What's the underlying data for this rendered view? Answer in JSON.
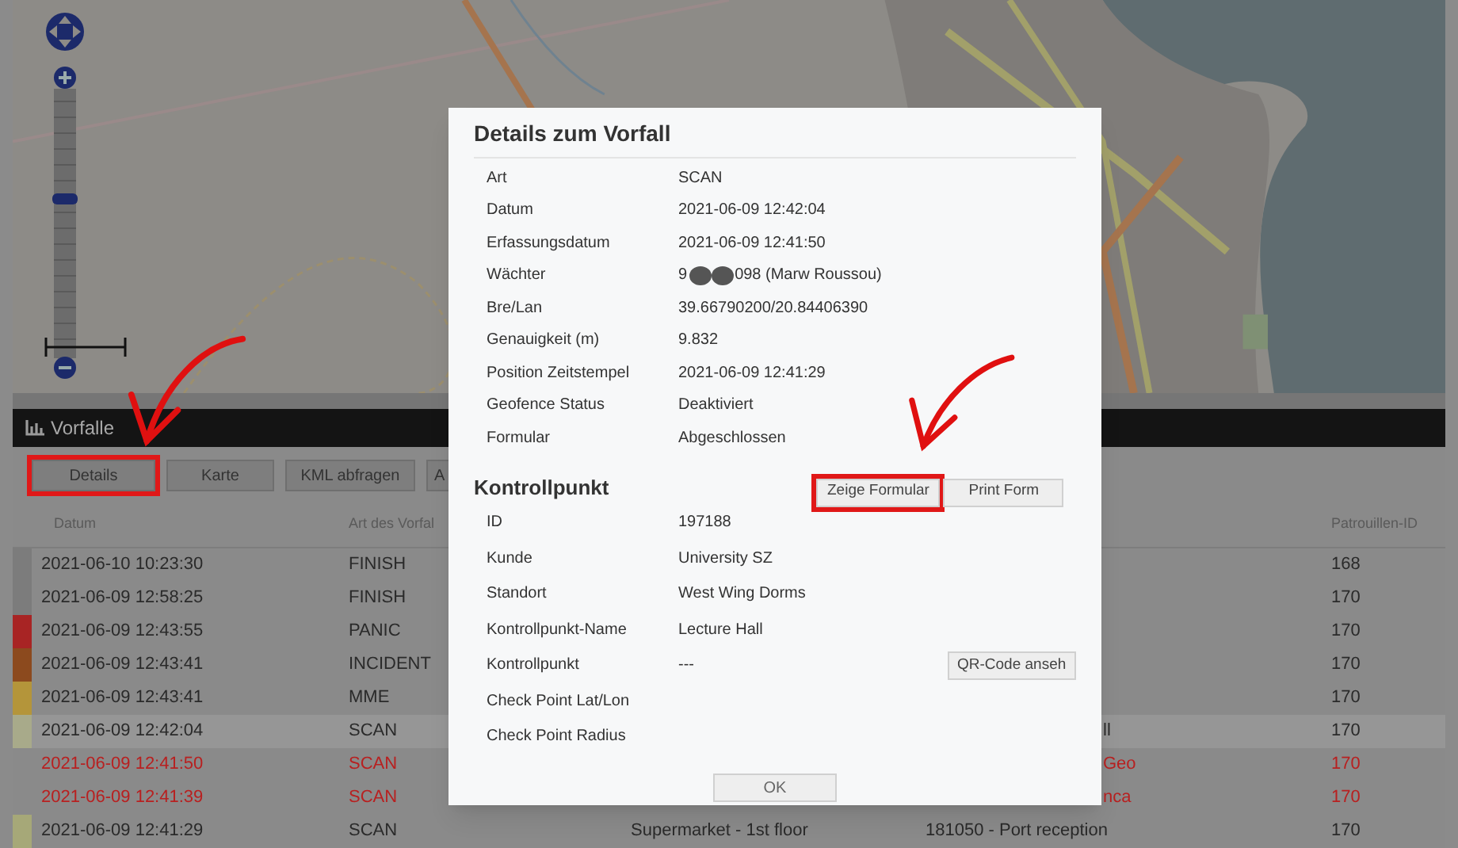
{
  "panel": {
    "title": "Vorfalle"
  },
  "toolbar": [
    {
      "label": "Details",
      "highlighted": true
    },
    {
      "label": "Karte",
      "highlighted": false
    },
    {
      "label": "KML abfragen",
      "highlighted": false
    },
    {
      "label": "A",
      "highlighted": false
    }
  ],
  "table": {
    "columns": [
      "Datum",
      "Art des Vorfal",
      "Patrouillen-ID"
    ],
    "rows": [
      {
        "date": "2021-06-10 10:23:30",
        "type": "FINISH",
        "patrol_id": "168",
        "color": "#7c7c7c",
        "alert": false,
        "selected": false
      },
      {
        "date": "2021-06-09 12:58:25",
        "type": "FINISH",
        "patrol_id": "170",
        "color": "#7c7c7c",
        "alert": false,
        "selected": false
      },
      {
        "date": "2021-06-09 12:43:55",
        "type": "PANIC",
        "patrol_id": "170",
        "color": "#a82424",
        "alert": false,
        "selected": false
      },
      {
        "date": "2021-06-09 12:43:41",
        "type": "INCIDENT",
        "patrol_id": "170",
        "color": "#8c4a1e",
        "alert": false,
        "selected": false
      },
      {
        "date": "2021-06-09 12:43:41",
        "type": "MME",
        "patrol_id": "170",
        "color": "#b4953a",
        "alert": false,
        "selected": false
      },
      {
        "date": "2021-06-09 12:42:04",
        "type": "SCAN",
        "column_4": "ll",
        "patrol_id": "170",
        "color": "#a8aa8a",
        "alert": false,
        "selected": true
      },
      {
        "date": "2021-06-09 12:41:50",
        "type": "SCAN",
        "column_4": "Geo",
        "patrol_id": "170",
        "alert": true,
        "selected": false
      },
      {
        "date": "2021-06-09 12:41:39",
        "type": "SCAN",
        "column_4": "nca",
        "patrol_id": "170",
        "alert": true,
        "selected": false
      },
      {
        "date": "2021-06-09 12:41:29",
        "type": "SCAN",
        "column_3": "Supermarket - 1st floor",
        "column_4": "181050 - Port reception",
        "patrol_id": "170",
        "color": "#a6a878",
        "alert": false,
        "selected": false
      }
    ]
  },
  "dialog": {
    "title": "Details zum Vorfall",
    "fields": [
      {
        "label": "Art",
        "value": "SCAN"
      },
      {
        "label": "Datum",
        "value": "2021-06-09 12:42:04"
      },
      {
        "label": "Erfassungsdatum",
        "value": "2021-06-09 12:41:50"
      },
      {
        "kind": "redacted",
        "label": "Wächter",
        "value_start": "9",
        "value_end": "098 (Marw Roussou)"
      },
      {
        "label": "Bre/Lan",
        "value": "39.66790200/20.84406390"
      },
      {
        "label": "Genauigkeit (m)",
        "value": "9.832"
      },
      {
        "label": "Position Zeitstempel",
        "value": "2021-06-09 12:41:29"
      },
      {
        "label": "Geofence Status",
        "value": "Deaktiviert"
      },
      {
        "label": "Formular",
        "value": "Abgeschlossen"
      }
    ],
    "section_title": "Kontrollpunkt",
    "section_buttons": [
      {
        "label": "Zeige Formular",
        "highlighted": true
      },
      {
        "label": "Print Form",
        "highlighted": false
      }
    ],
    "checkpoint_fields": [
      {
        "label": "ID",
        "value": "197188"
      },
      {
        "label": "Kunde",
        "value": "University SZ"
      },
      {
        "label": "Standort",
        "value": "West Wing Dorms"
      },
      {
        "label": "Kontrollpunkt-Name",
        "value": "Lecture Hall"
      },
      {
        "label": "Kontrollpunkt",
        "value": "---",
        "button": "QR-Code anseh"
      },
      {
        "label": "Check Point Lat/Lon"
      },
      {
        "label": "Check Point Radius"
      }
    ],
    "ok": "OK"
  }
}
